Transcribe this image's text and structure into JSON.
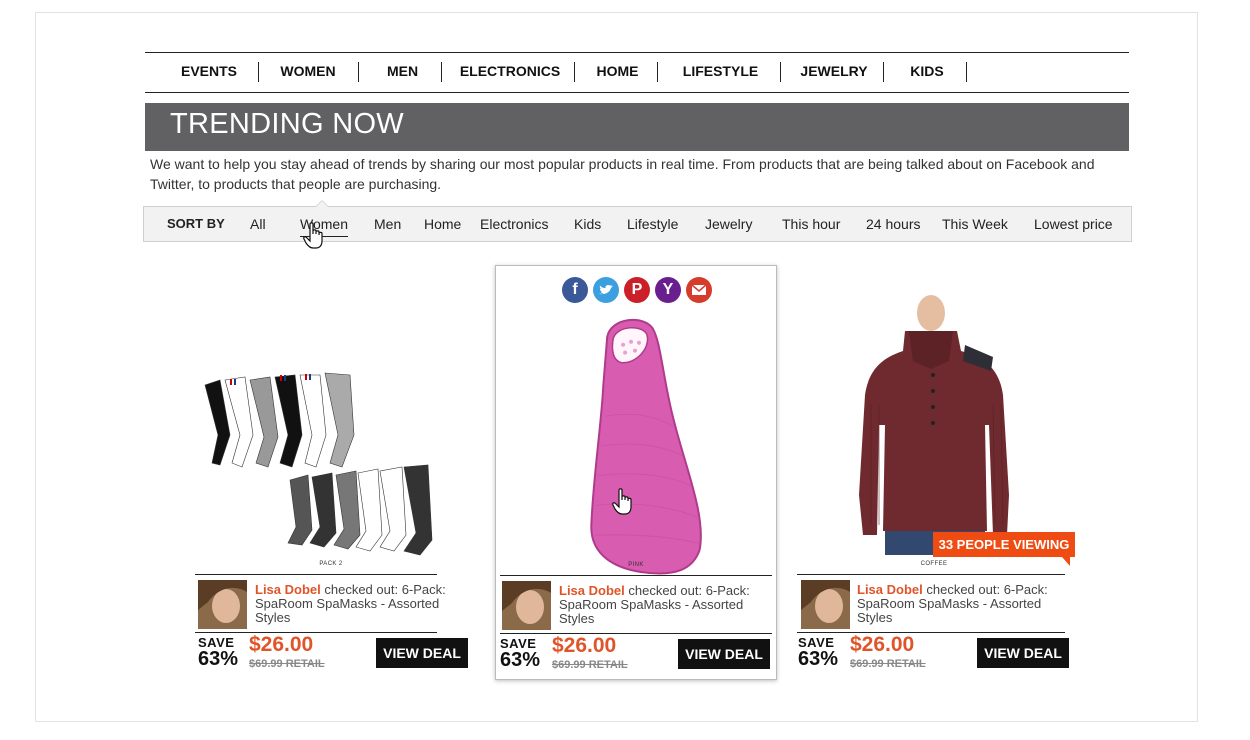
{
  "nav": {
    "items": [
      "EVENTS",
      "WOMEN",
      "MEN",
      "ELECTRONICS",
      "HOME",
      "LIFESTYLE",
      "JEWELRY",
      "KIDS"
    ]
  },
  "banner": {
    "title": "TRENDING NOW"
  },
  "intro": "We want to help you stay ahead of trends by sharing our most popular products in real time. From products that are being talked about on Facebook and Twitter, to products that people are purchasing.",
  "sort": {
    "label": "SORT BY",
    "options": [
      "All",
      "Women",
      "Men",
      "Home",
      "Electronics",
      "Kids",
      "Lifestyle",
      "Jewelry",
      "This hour",
      "24 hours",
      "This Week",
      "Lowest price"
    ],
    "active": "Women"
  },
  "share_icons": [
    "facebook-icon",
    "twitter-icon",
    "pinterest-icon",
    "yahoo-icon",
    "email-icon"
  ],
  "products": [
    {
      "caption": "PACK 2",
      "user": "Lisa Dobel",
      "activity": " checked out: 6-Pack: SpaRoom SpaMasks - Assorted Styles",
      "save_label": "SAVE",
      "save_pct": "63%",
      "price": "$26.00",
      "retail": "$69.99 RETAIL",
      "cta": "VIEW DEAL"
    },
    {
      "caption": "PINK",
      "user": "Lisa Dobel",
      "activity": " checked out: 6-Pack: SpaRoom SpaMasks - Assorted Styles",
      "save_label": "SAVE",
      "save_pct": "63%",
      "price": "$26.00",
      "retail": "$69.99 RETAIL",
      "cta": "VIEW DEAL"
    },
    {
      "caption": "COFFEE",
      "user": "Lisa Dobel",
      "activity": " checked out: 6-Pack: SpaRoom SpaMasks - Assorted Styles",
      "save_label": "SAVE",
      "save_pct": "63%",
      "price": "$26.00",
      "retail": "$69.99 RETAIL",
      "cta": "VIEW DEAL",
      "badge": "33 PEOPLE VIEWING"
    }
  ],
  "colors": {
    "accent": "#e0542a",
    "banner": "#616164",
    "badge": "#ef4c14"
  }
}
